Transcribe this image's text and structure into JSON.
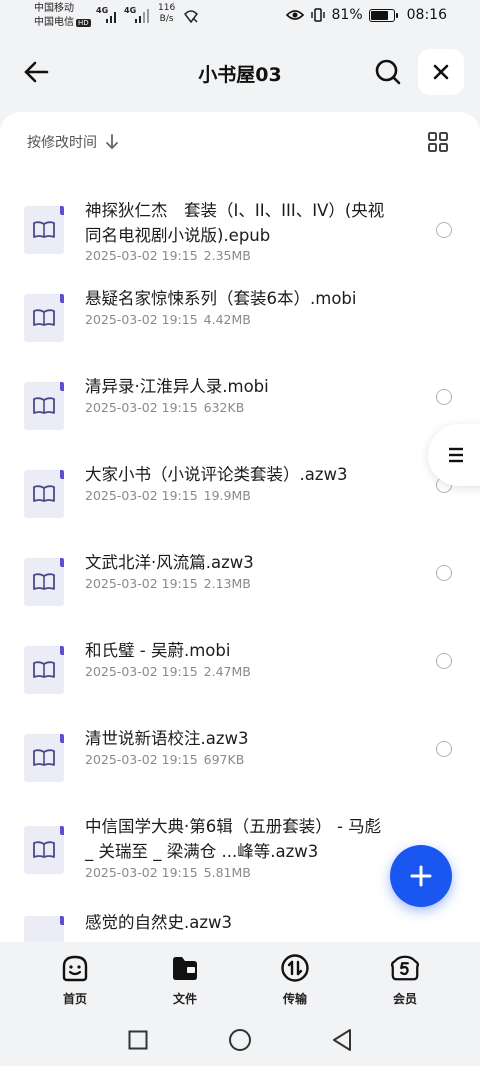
{
  "status_bar": {
    "carrier_1": "中国移动",
    "carrier_2": "中国电信",
    "hd_badge": "HD",
    "network_1": "4G",
    "network_2": "4G",
    "speed_value": "116",
    "speed_unit": "B/s",
    "battery_text": "81%",
    "battery_level": 0.81,
    "time": "08:16"
  },
  "header": {
    "title": "小书屋03"
  },
  "toolbar": {
    "sort_label": "按修改时间"
  },
  "files": [
    {
      "name": "神探狄仁杰　套装（I、II、III、IV）(央视同名电视剧小说版).epub",
      "date": "2025-03-02 19:15",
      "size": "2.35MB"
    },
    {
      "name": "悬疑名家惊悚系列（套装6本）.mobi",
      "date": "2025-03-02 19:15",
      "size": "4.42MB"
    },
    {
      "name": "清异录·江淮异人录.mobi",
      "date": "2025-03-02 19:15",
      "size": "632KB"
    },
    {
      "name": "大家小书（小说评论类套装）.azw3",
      "date": "2025-03-02 19:15",
      "size": "19.9MB"
    },
    {
      "name": "文武北洋·风流篇.azw3",
      "date": "2025-03-02 19:15",
      "size": "2.13MB"
    },
    {
      "name": "和氏璧 - 吴蔚.mobi",
      "date": "2025-03-02 19:15",
      "size": "2.47MB"
    },
    {
      "name": "清世说新语校注.azw3",
      "date": "2025-03-02 19:15",
      "size": "697KB"
    },
    {
      "name": "中信国学大典·第6辑（五册套装） - 马彪 _ 关瑞至 _ 梁满仓 ...峰等.azw3",
      "date": "2025-03-02 19:15",
      "size": "5.81MB"
    },
    {
      "name": "感觉的自然史.azw3",
      "date": "",
      "size": ""
    }
  ],
  "bottom_nav": [
    {
      "label": "首页",
      "icon": "home-face-icon"
    },
    {
      "label": "文件",
      "icon": "folder-icon"
    },
    {
      "label": "传输",
      "icon": "transfer-icon"
    },
    {
      "label": "会员",
      "icon": "vip-icon"
    }
  ],
  "colors": {
    "accent": "#1a56f0",
    "file_icon_bg": "#ececf6",
    "file_icon_corner": "#5b4fd6"
  }
}
